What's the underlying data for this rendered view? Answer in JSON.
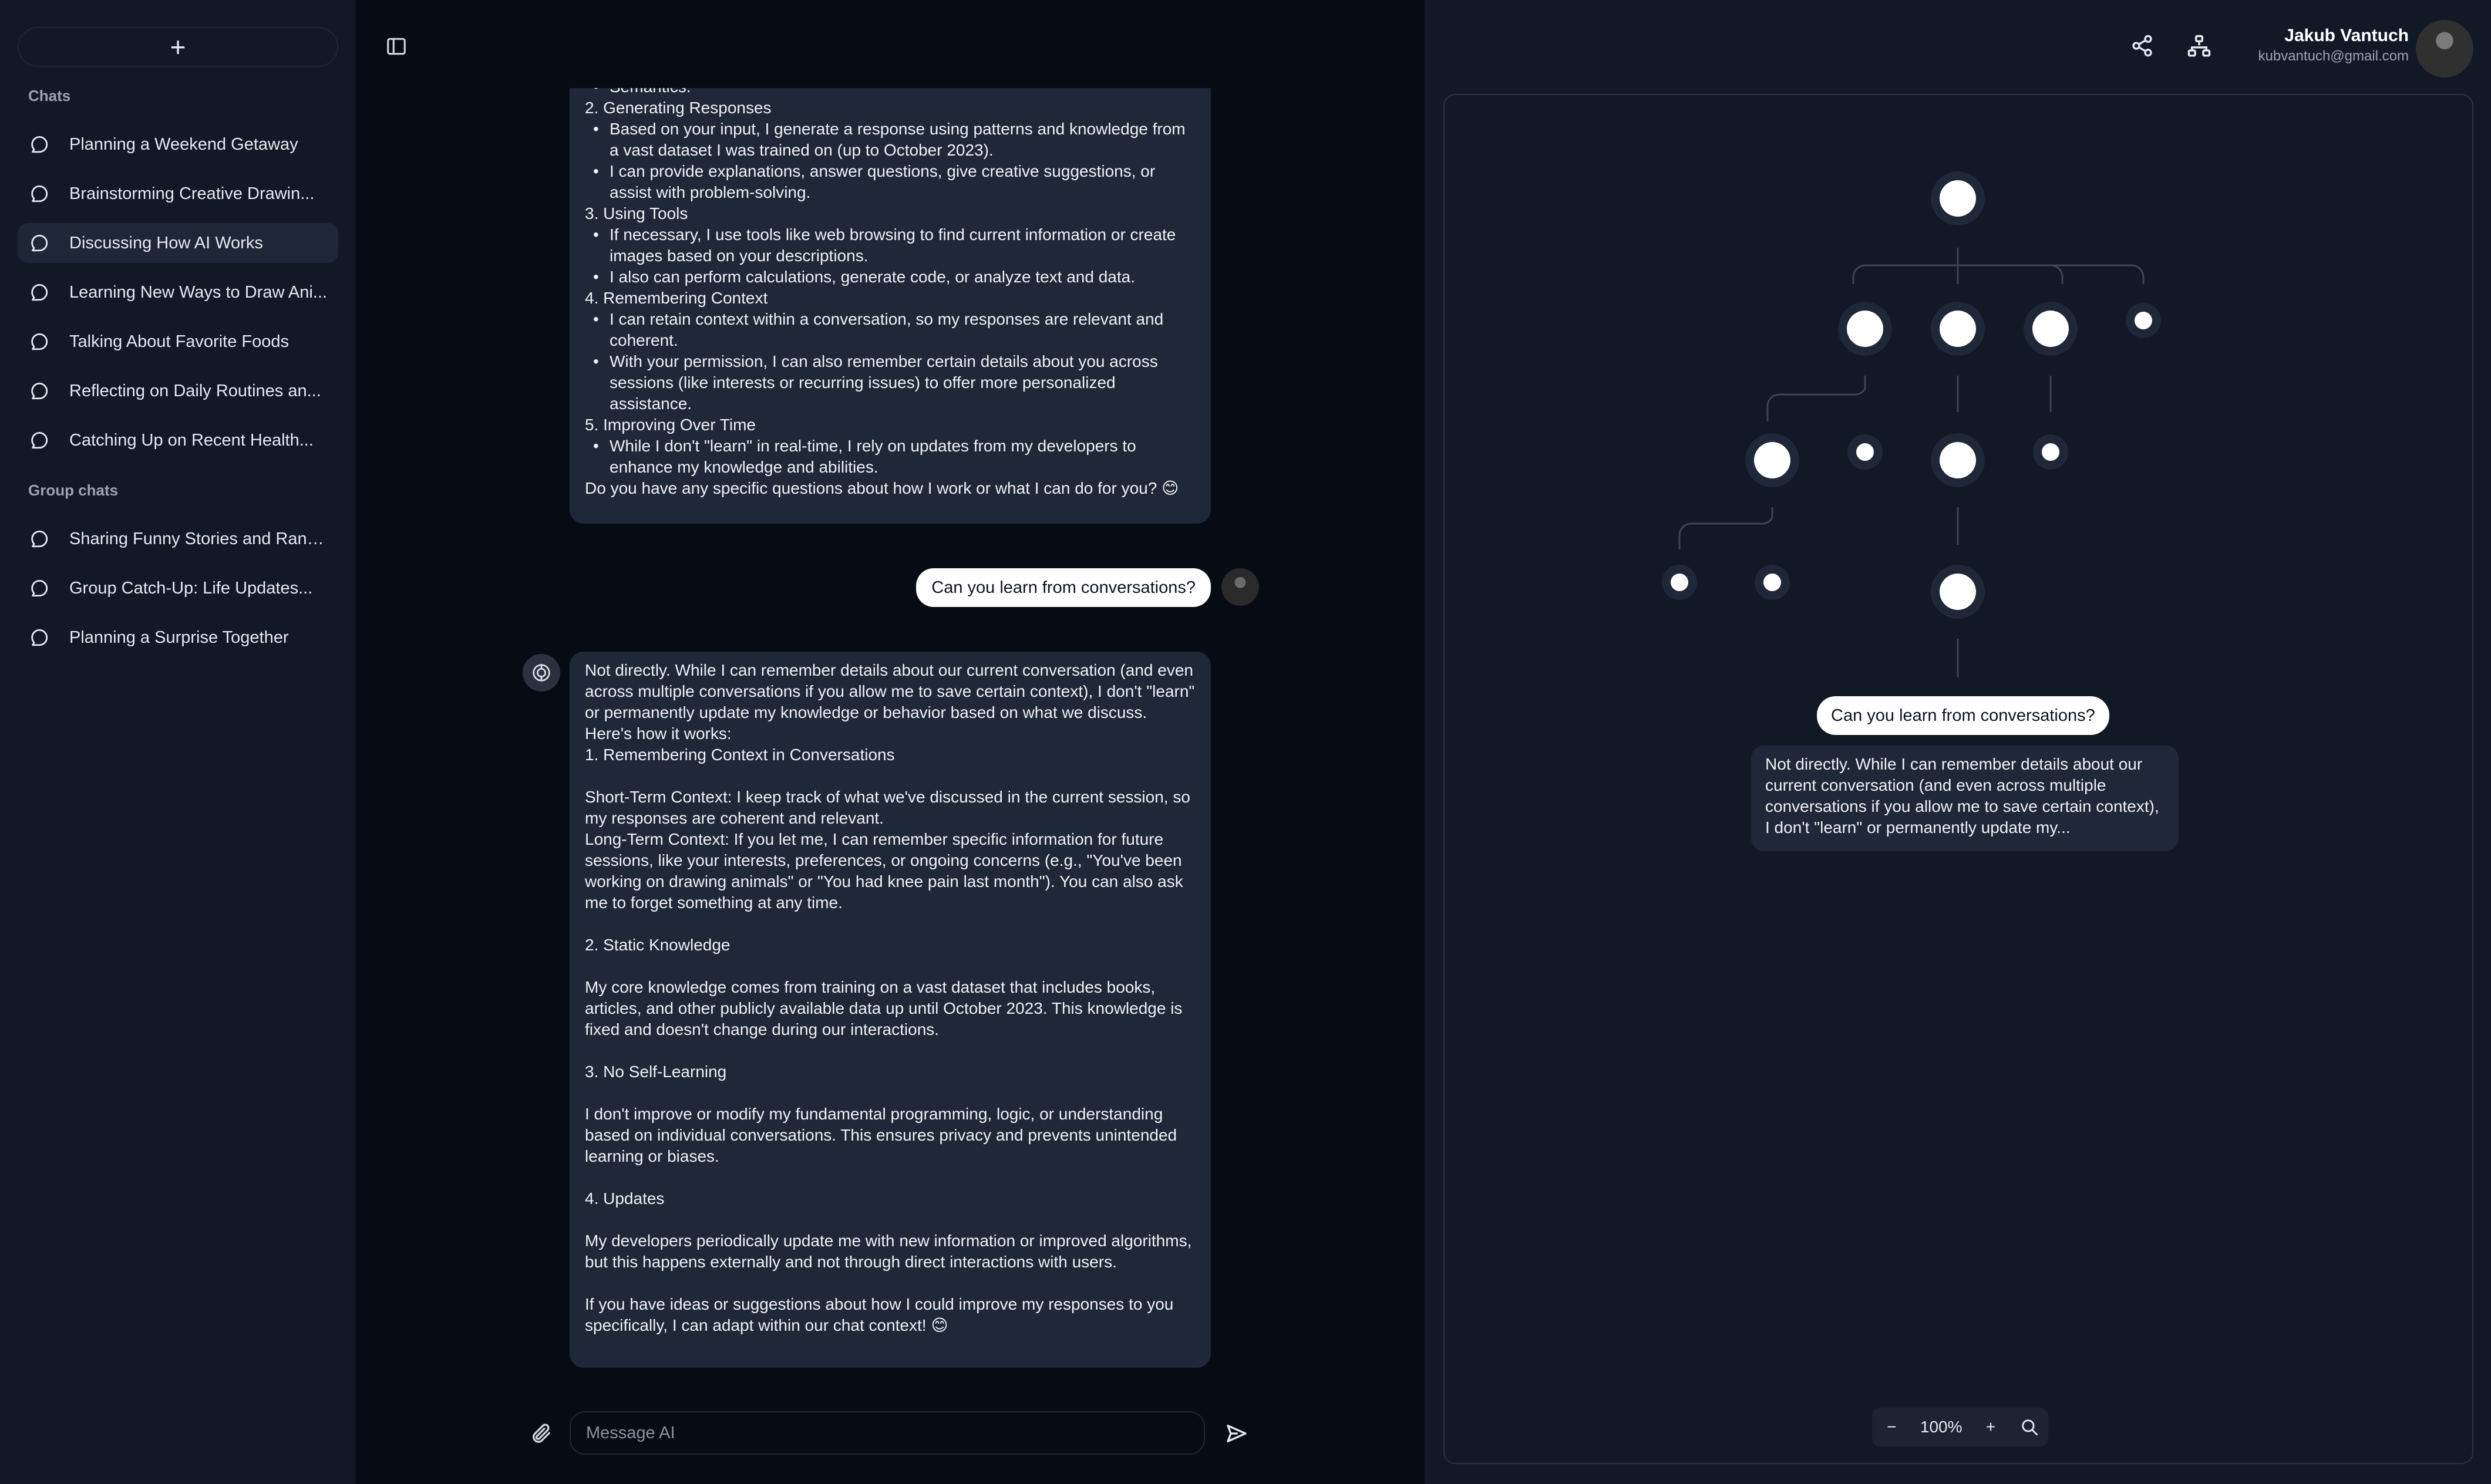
{
  "sidebar": {
    "new_chat_label": "+",
    "chats_title": "Chats",
    "chats": [
      "Planning a Weekend Getaway",
      "Brainstorming Creative Drawin...",
      "Discussing How AI Works",
      "Learning New Ways to Draw Ani...",
      "Talking About Favorite Foods",
      "Reflecting on Daily Routines an...",
      "Catching Up on Recent Health..."
    ],
    "active_index": 2,
    "group_title": "Group chats",
    "groups": [
      "Sharing Funny Stories and Rand...",
      "Group Catch-Up: Life Updates...",
      "Planning a Surprise Together"
    ]
  },
  "chat": {
    "msg1_lines": [
      {
        "t": "Semantics.",
        "k": "li"
      },
      {
        "t": "2. Generating Responses",
        "k": "line"
      },
      {
        "t": "Based on your input, I generate a response using patterns and knowledge from a vast dataset I was trained on (up to October 2023).",
        "k": "li"
      },
      {
        "t": "I can provide explanations, answer questions, give creative suggestions, or assist with problem-solving.",
        "k": "li"
      },
      {
        "t": "3. Using Tools",
        "k": "line"
      },
      {
        "t": "If necessary, I use tools like web browsing to find current information or create images based on your descriptions.",
        "k": "li"
      },
      {
        "t": "I also can perform calculations, generate code, or analyze text and data.",
        "k": "li"
      },
      {
        "t": "4. Remembering Context",
        "k": "line"
      },
      {
        "t": "I can retain context within a conversation, so my responses are relevant and coherent.",
        "k": "li"
      },
      {
        "t": "With your permission, I can also remember certain details about you across sessions (like interests or recurring issues) to offer more personalized assistance.",
        "k": "li"
      },
      {
        "t": "5. Improving Over Time",
        "k": "line"
      },
      {
        "t": "While I don't \"learn\" in real-time, I rely on updates from my developers to enhance my knowledge and abilities.",
        "k": "li"
      },
      {
        "t": "Do you have any specific questions about how I work or what I can do for you? 😊",
        "k": "line"
      }
    ],
    "user_question": "Can you learn from conversations?",
    "msg2_lines": [
      {
        "t": "Not directly. While I can remember details about our current conversation (and even across multiple conversations if you allow me to save certain context), I don't \"learn\" or permanently update my knowledge or behavior based on what we discuss. Here's how it works:",
        "k": "line"
      },
      {
        "t": "1. Remembering Context in Conversations",
        "k": "line"
      },
      {
        "t": "",
        "k": "gap"
      },
      {
        "t": "   Short-Term Context: I keep track of what we've discussed in the current session, so my responses are coherent and relevant.",
        "k": "line"
      },
      {
        "t": "   Long-Term Context: If you let me, I can remember specific information for future sessions, like your interests, preferences, or ongoing concerns (e.g., \"You've been working on drawing animals\" or \"You had knee pain last month\"). You can also ask me to forget something at any time.",
        "k": "line"
      },
      {
        "t": "",
        "k": "gap"
      },
      {
        "t": "2. Static Knowledge",
        "k": "line"
      },
      {
        "t": "",
        "k": "gap"
      },
      {
        "t": "   My core knowledge comes from training on a vast dataset that includes books, articles, and other publicly available data up until October 2023. This knowledge is fixed and doesn't change during our interactions.",
        "k": "line"
      },
      {
        "t": "",
        "k": "gap"
      },
      {
        "t": "3. No Self-Learning",
        "k": "line"
      },
      {
        "t": "",
        "k": "gap"
      },
      {
        "t": "   I don't improve or modify my fundamental programming, logic, or understanding based on individual conversations. This ensures privacy and prevents unintended learning or biases.",
        "k": "line"
      },
      {
        "t": "",
        "k": "gap"
      },
      {
        "t": "4. Updates",
        "k": "line"
      },
      {
        "t": "",
        "k": "gap"
      },
      {
        "t": "   My developers periodically update me with new information or improved algorithms, but this happens externally and not through direct interactions with users.",
        "k": "line"
      },
      {
        "t": "",
        "k": "gap"
      },
      {
        "t": "If you have ideas or suggestions about how I could improve my responses to you specifically, I can adapt within our chat context! 😊",
        "k": "line"
      }
    ],
    "composer_placeholder": "Message AI"
  },
  "header": {
    "user_name": "Jakub Vantuch",
    "user_email": "kubvantuch@gmail.com"
  },
  "tree": {
    "node_question": "Can you learn from conversations?",
    "node_answer": "Not directly. While I can remember details about our current conversation (and even across multiple conversations if you allow me to save certain context), I don't \"learn\" or permanently update my..."
  },
  "zoom": {
    "level": "100%",
    "minus": "−",
    "plus": "+"
  },
  "colors": {
    "background": "#070b13",
    "sidebar": "#111826",
    "bubble": "#1f2838",
    "accent": "#ffffff"
  }
}
